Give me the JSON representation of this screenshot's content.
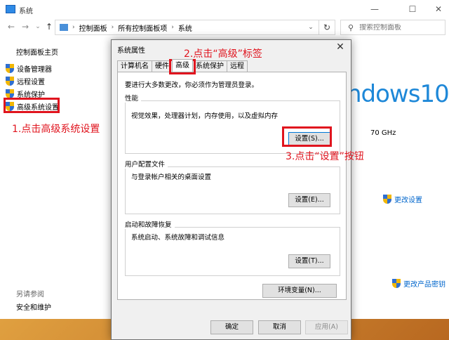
{
  "window": {
    "title": "系统",
    "minimize": "—",
    "maximize": "☐",
    "close": "✕"
  },
  "addressbar": {
    "breadcrumbs": [
      "控制面板",
      "所有控制面板项",
      "系统"
    ],
    "search_placeholder": "搜索控制面板"
  },
  "sidebar": {
    "title": "控制面板主页",
    "items": [
      {
        "label": "设备管理器"
      },
      {
        "label": "远程设置"
      },
      {
        "label": "系统保护"
      },
      {
        "label": "高级系统设置"
      }
    ],
    "see_also": "另请参阅",
    "security_link": "安全和维护"
  },
  "main": {
    "windows_logo": "ndows10",
    "cpu_speed": "70 GHz",
    "change_settings": "更改设置",
    "change_product_key": "更改产品密钥"
  },
  "dialog": {
    "title": "系统属性",
    "close": "✕",
    "tabs": [
      "计算机名",
      "硬件",
      "高级",
      "系统保护",
      "远程"
    ],
    "active_tab": "高级",
    "admin_note": "要进行大多数更改，你必须作为管理员登录。",
    "performance": {
      "title": "性能",
      "desc": "视觉效果，处理器计划，内存使用，以及虚拟内存",
      "button": "设置(S)..."
    },
    "user_profiles": {
      "title": "用户配置文件",
      "desc": "与登录帐户相关的桌面设置",
      "button": "设置(E)..."
    },
    "startup_recovery": {
      "title": "启动和故障恢复",
      "desc": "系统启动、系统故障和调试信息",
      "button": "设置(T)..."
    },
    "env_button": "环境变量(N)...",
    "ok": "确定",
    "cancel": "取消",
    "apply": "应用(A)"
  },
  "annotations": {
    "step1": "1.点击高级系统设置",
    "step2": "2.点击“高级”标签",
    "step3": "3.点击“设置”按钮"
  },
  "colors": {
    "annotation_red": "#e0141e",
    "link_blue": "#0066cc",
    "windows_blue": "#1e88d8"
  }
}
